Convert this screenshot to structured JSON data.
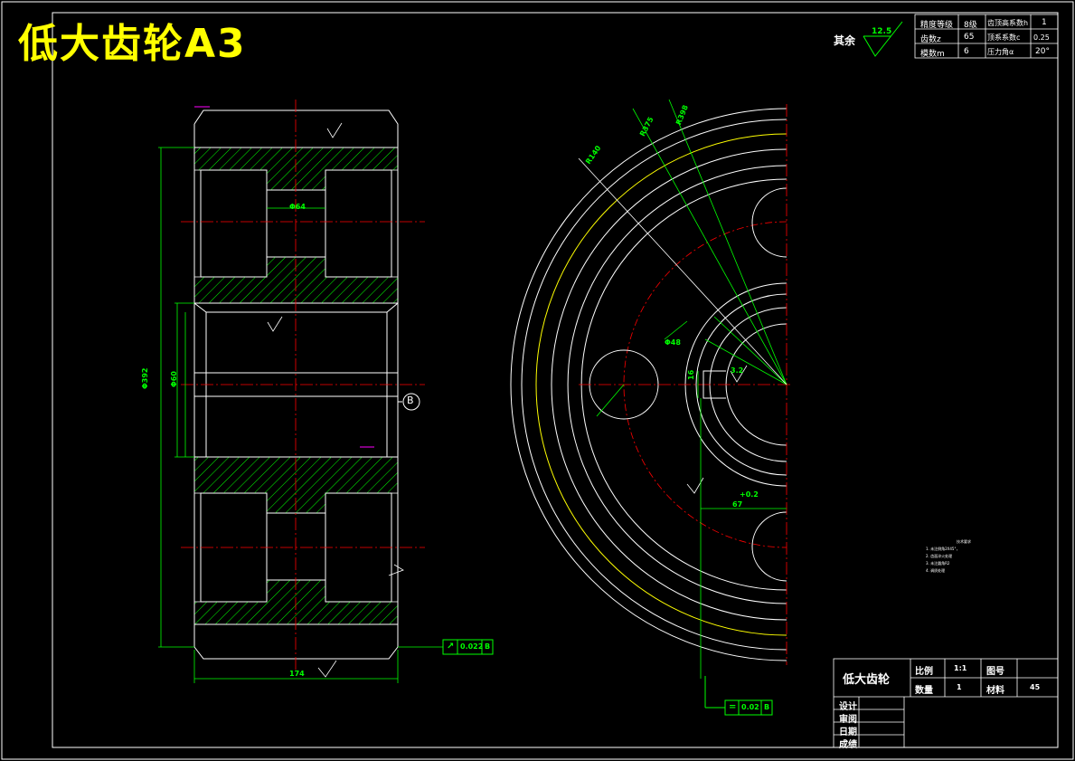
{
  "drawing_title": "低大齿轮A3",
  "surface_finish_note": {
    "label": "其余",
    "value": "12.5"
  },
  "gear_params": [
    {
      "name": "精度等级",
      "value": "8级",
      "name2": "齿顶高系数h",
      "value2": "1"
    },
    {
      "name": "齿数z",
      "value": "65",
      "name2": "顶系系数c",
      "value2": "0.25"
    },
    {
      "name": "模数m",
      "value": "6",
      "name2": "压力角α",
      "value2": "20°"
    }
  ],
  "dimensions": {
    "hub_dia": "Φ64",
    "total_dia": "Φ392",
    "bore_dia": "Φ60",
    "width": "174",
    "r1": "R140",
    "r2": "R375",
    "r3": "R398",
    "hole_dia": "Φ48",
    "key_width": "16",
    "key_depth": "67",
    "key_tol": "+0.2",
    "roughness_small": "3.2",
    "datum": "B"
  },
  "tolerances": [
    {
      "symbol": "↗",
      "value": "0.022",
      "datum": "B"
    },
    {
      "symbol": "=",
      "value": "0.02",
      "datum": "B"
    }
  ],
  "tech_notes": {
    "title": "技术要求",
    "items": [
      "1. 未注倒角2X45°，",
      "2. 齿面淬火处理",
      "3. 未注圆角R2",
      "4. 调质处理"
    ]
  },
  "title_block": {
    "part_name": "低大齿轮",
    "scale_label": "比例",
    "scale_value": "1:1",
    "drawing_no_label": "图号",
    "qty_label": "数量",
    "qty_value": "1",
    "material_label": "材料",
    "material_value": "45",
    "rows": [
      "设计",
      "审阅",
      "日期",
      "成绩"
    ]
  },
  "colors": {
    "outline": "#ffffff",
    "dimension": "#00ff00",
    "centerline": "#ff0000",
    "hatch": "#00ff00",
    "circle_yellow": "#ffff00",
    "magenta": "#ff00ff"
  }
}
